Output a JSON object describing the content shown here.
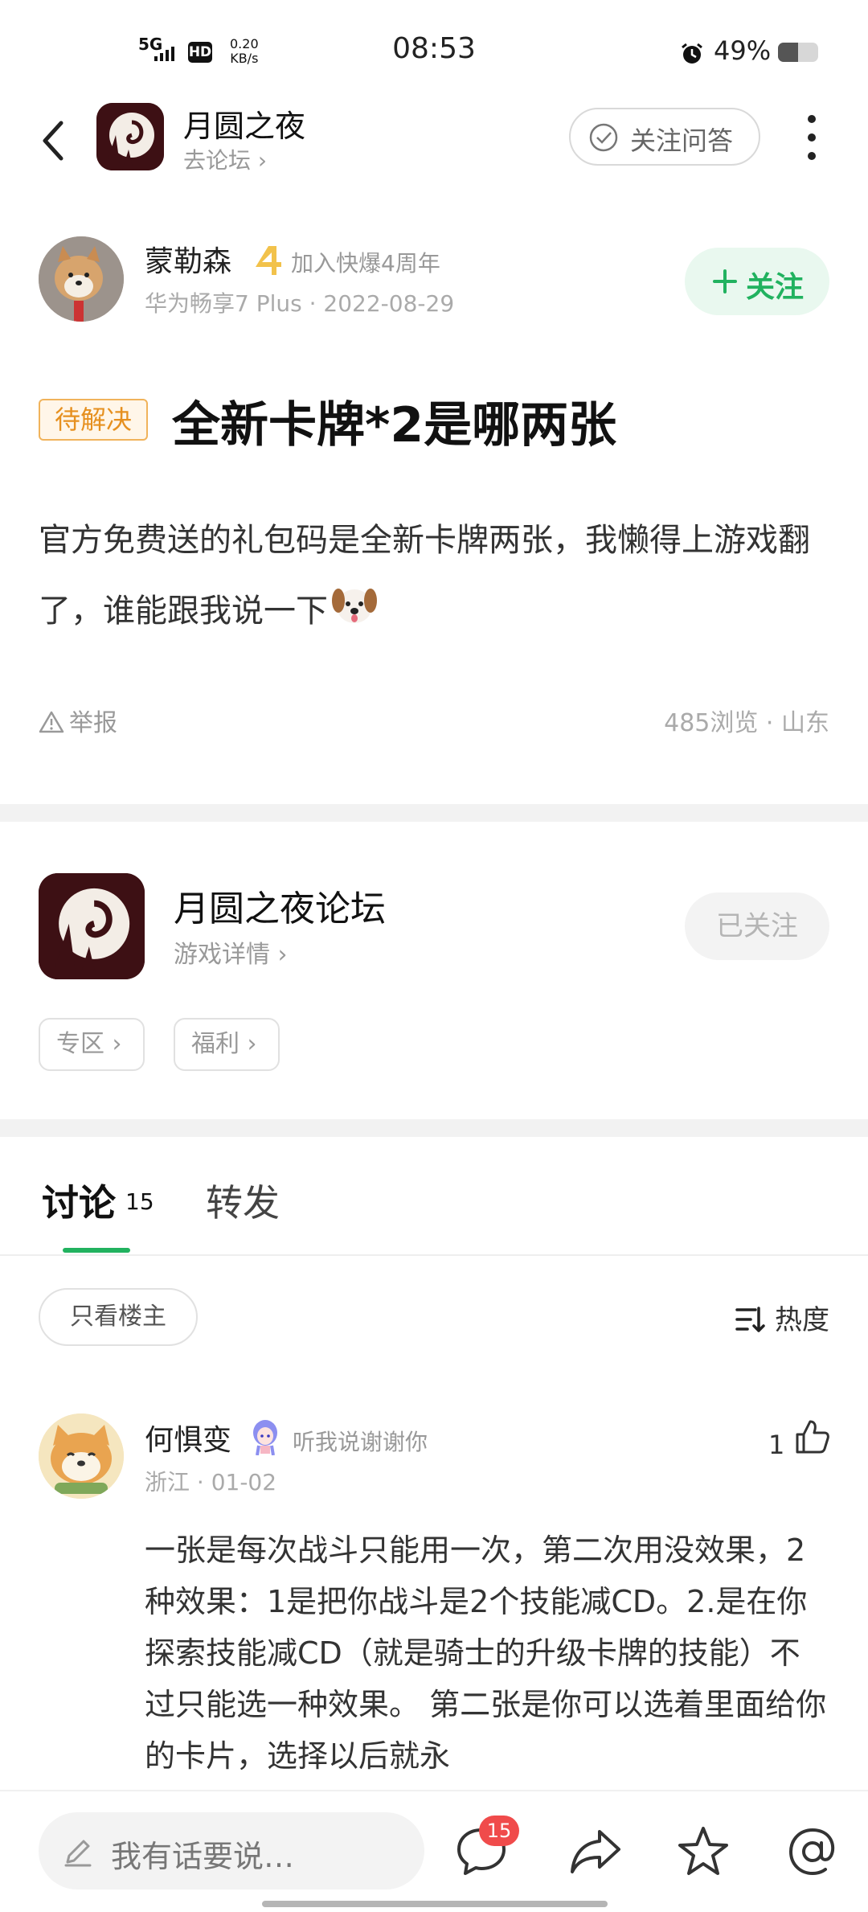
{
  "status_bar": {
    "signal": "5G",
    "hd": "HD",
    "speed_value": "0.20",
    "speed_unit": "KB/s",
    "time": "08:53",
    "battery_pct_label": "49%",
    "battery_level": 0.49
  },
  "header": {
    "app_name": "月圆之夜",
    "app_sub": "去论坛 ›",
    "follow_qa_label": "关注问答"
  },
  "author": {
    "name": "蒙勒森",
    "tag": "加入快爆4周年",
    "meta": "华为畅享7 Plus  ·  2022-08-29",
    "follow_label": "关注"
  },
  "question": {
    "status": "待解决",
    "title": "全新卡牌*2是哪两张",
    "body": "官方免费送的礼包码是全新卡牌两张，我懒得上游戏翻了，谁能跟我说一下",
    "report_label": "举报",
    "views_location": "485浏览  ·  山东"
  },
  "forum": {
    "name": "月圆之夜论坛",
    "sub": "游戏详情 ›",
    "followed_label": "已关注",
    "chips": [
      "专区 ›",
      "福利 ›"
    ]
  },
  "tabs": {
    "discussion_label": "讨论",
    "discussion_count": "15",
    "forward_label": "转发"
  },
  "filters": {
    "only_host_label": "只看楼主",
    "sort_label": "热度"
  },
  "comment": {
    "name": "何惧变",
    "tag": "听我说谢谢你",
    "meta": "浙江  ·  01-02",
    "likes": "1",
    "body": "一张是每次战斗只能用一次，第二次用没效果，2种效果：1是把你战斗是2个技能减CD。2.是在你探索技能减CD（就是骑士的升级卡牌的技能）不过只能选一种效果。    第二张是你可以选着里面给你的卡片，选择以后就永"
  },
  "bottom_bar": {
    "input_placeholder": "我有话要说…",
    "comment_badge": "15"
  },
  "colors": {
    "accent_green": "#21b25f",
    "status_orange": "#e6901f",
    "badge_red": "#f04b4b"
  },
  "icons": [
    "back-arrow-icon",
    "check-circle-icon",
    "more-vertical-icon",
    "plus-icon",
    "warning-icon",
    "sort-icon",
    "thumbs-up-icon",
    "pencil-icon",
    "comment-icon",
    "share-icon",
    "star-icon",
    "at-icon"
  ]
}
